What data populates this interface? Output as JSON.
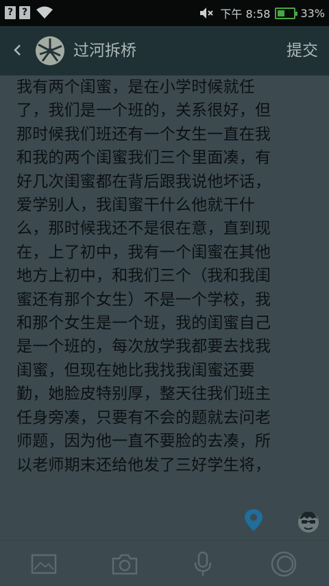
{
  "status_bar": {
    "time": "下午 8:58",
    "battery_percent": "33%",
    "battery_level": 0.33,
    "icons": [
      "unknown-app-icon",
      "unknown-app-icon",
      "wifi-icon",
      "mute-icon",
      "battery-icon"
    ]
  },
  "header": {
    "title": "过河拆桥",
    "submit_label": "提交",
    "back_icon": "chevron-left-icon"
  },
  "post": {
    "lines": [
      "我有两个闺蜜，是在小学时候就任",
      "了，我们是一个班的，关系很好，但",
      "那时候我们班还有一个女生一直在我",
      "和我的两个闺蜜我们三个里面凑，有",
      "好几次闺蜜都在背后跟我说他坏话，",
      "爱学别人，我闺蜜干什么他就干什",
      "么，那时候我还不是很在意，直到现",
      "在，上了初中，我有一个闺蜜在其他",
      "地方上初中，和我们三个（我和我闺",
      "蜜还有那个女生）不是一个学校，我",
      "和那个女生是一个班，我的闺蜜自己",
      "是一个班的，每次放学我都要去找我",
      "闺蜜，但现在她比我找我闺蜜还要",
      "勤，她脸皮特别厚，整天往我们班主",
      "任身旁凑，只要有不会的题就去问老",
      "师题，因为他一直不要脸的去凑，所",
      "以老师期末还给他发了三好学生将，"
    ]
  },
  "floating": {
    "location_icon": "location-pin-icon",
    "emoji_icon": "emoji-face-icon"
  },
  "toolbar": {
    "items": [
      "image-icon",
      "camera-icon",
      "microphone-icon",
      "circle-icon"
    ]
  },
  "colors": {
    "status_bar_bg": "#080a0a",
    "header_bg": "#1f3134",
    "body_bg": "#3c4a50",
    "text": "#0c1012",
    "accent_blue": "#1f6e9c",
    "battery_green": "#49a644"
  }
}
